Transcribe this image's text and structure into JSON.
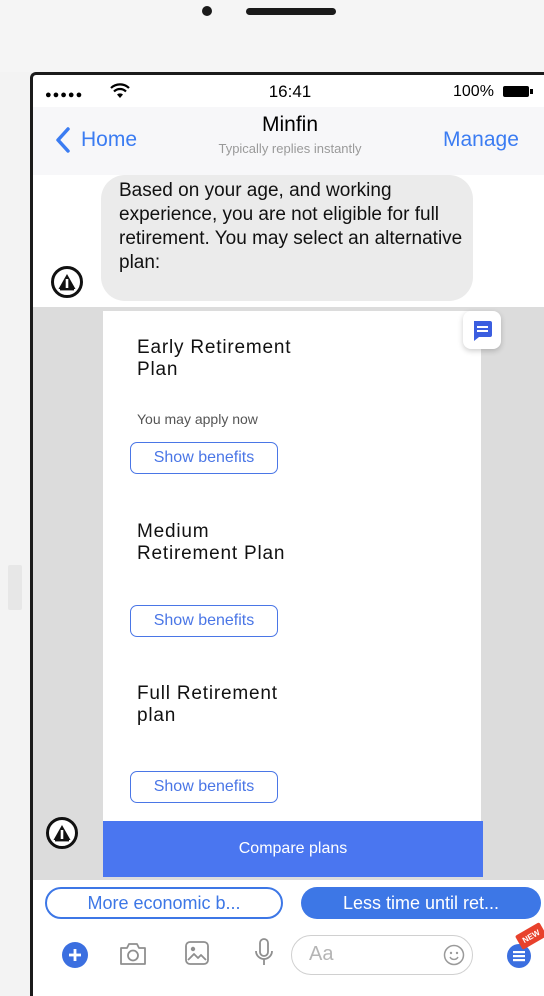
{
  "status_bar": {
    "signal": "●●●●●",
    "time": "16:41",
    "battery": "100%"
  },
  "nav": {
    "back_label": "Home",
    "title": "Minfin",
    "subtitle": "Typically replies instantly",
    "manage_label": "Manage"
  },
  "message": {
    "text": "Based on your age, and working experience, you are not eligible for full retirement. You may select an alternative plan:"
  },
  "plans": [
    {
      "title_line1": "Early Retirement",
      "title_line2": "Plan",
      "subtitle": "You may apply now",
      "button": "Show benefits"
    },
    {
      "title_line1": "Medium",
      "title_line2": "Retirement Plan",
      "subtitle": "",
      "button": "Show benefits"
    },
    {
      "title_line1": "Full Retirement",
      "title_line2": "plan",
      "subtitle": "",
      "button": "Show benefits"
    }
  ],
  "compare_button": "Compare plans",
  "quick_replies": [
    "More economic b...",
    "Less time until ret..."
  ],
  "composer": {
    "placeholder": "Aa",
    "badge": "NEW"
  },
  "colors": {
    "accent": "#3d77e6",
    "compare_bg": "#4a76f0",
    "bubble_bg": "#ebebeb",
    "carousel_bg": "#dcdcdc",
    "badge": "#e8412c"
  },
  "icons": [
    "wifi-icon",
    "battery-icon",
    "back-chevron-icon",
    "bot-avatar-icon",
    "message-icon",
    "add-icon",
    "camera-icon",
    "gallery-icon",
    "microphone-icon",
    "emoji-icon",
    "menu-icon"
  ]
}
